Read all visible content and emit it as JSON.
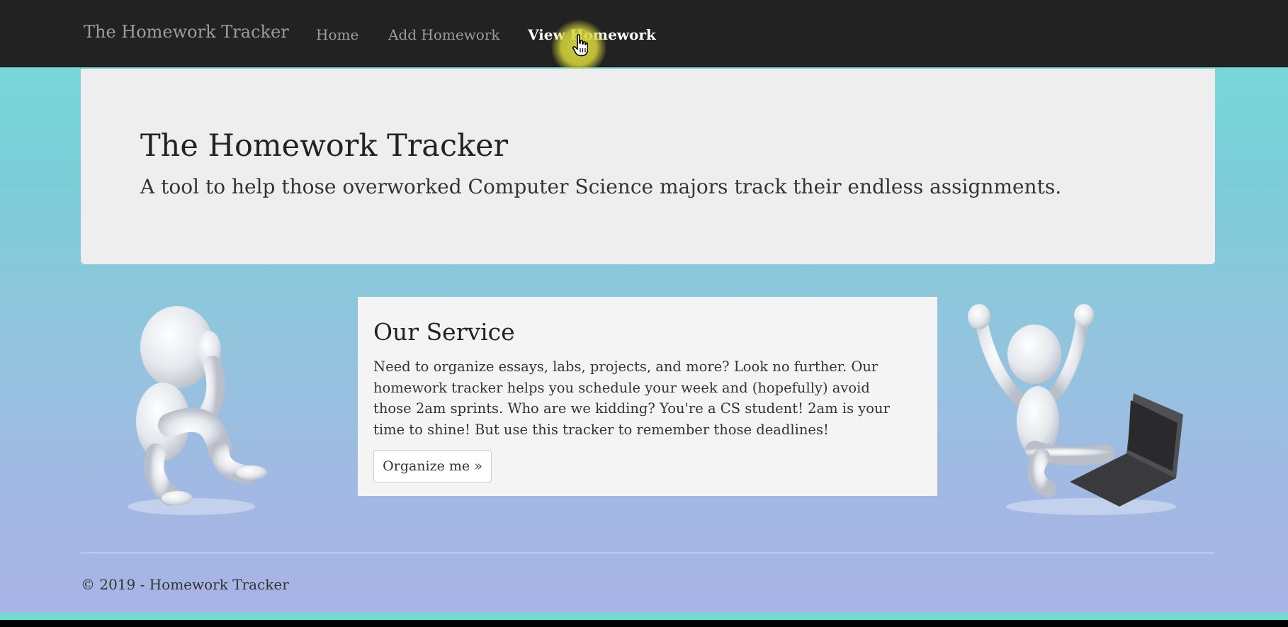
{
  "navbar": {
    "brand": "The Homework Tracker",
    "links": [
      {
        "label": "Home",
        "active": false
      },
      {
        "label": "Add Homework",
        "active": false
      },
      {
        "label": "View Homework",
        "active": true
      }
    ]
  },
  "jumbotron": {
    "title": "The Homework Tracker",
    "subtitle": "A tool to help those overworked Computer Science majors track their endless assignments."
  },
  "service": {
    "title": "Our Service",
    "text": "Need to organize essays, labs, projects, and more? Look no further. Our homework tracker helps you schedule your week and (hopefully) avoid those 2am sprints. Who are we kidding? You're a CS student! 2am is your time to shine! But use this tracker to remember those deadlines!",
    "button_label": "Organize me »"
  },
  "footer": {
    "text": "© 2019 - Homework Tracker"
  },
  "colors": {
    "navbar_bg": "#222222",
    "nav_text": "#9d9d9d",
    "nav_active": "#ffffff",
    "jumbotron_bg": "#eeeeee",
    "card_bg": "#f4f4f4",
    "bg_gradient_top": "#73dcd8",
    "bg_gradient_bottom": "#a9b3e6",
    "cursor_highlight": "#d6d63c"
  },
  "illustrations": {
    "left": "stressed-stick-figure",
    "right": "celebrating-stick-figure-with-laptop"
  }
}
